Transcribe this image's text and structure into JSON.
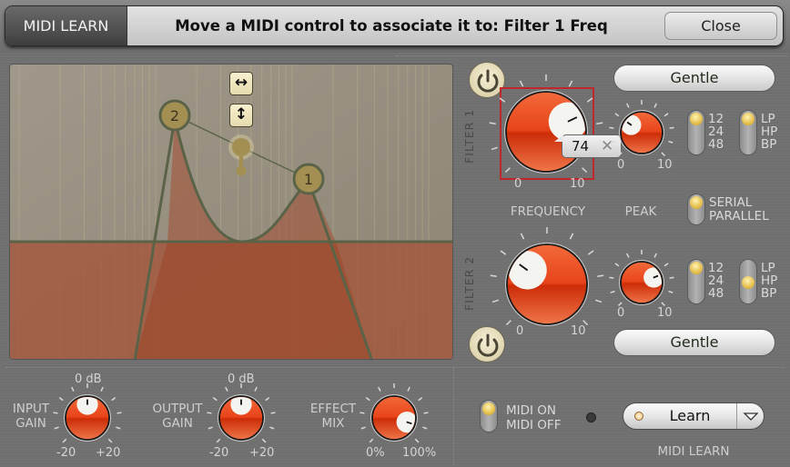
{
  "midi_banner": {
    "tag": "MIDI LEARN",
    "message": "Move a MIDI control to associate it to: Filter 1 Freq",
    "close_label": "Close"
  },
  "graph": {
    "node_labels": [
      "2",
      "1"
    ],
    "icons": [
      "horizontal-move-icon",
      "vertical-move-icon"
    ],
    "colors": {
      "background": "#928b7d",
      "fill": "#a4553a",
      "curve": "#5a6347",
      "node": "#a38f52"
    }
  },
  "filter1": {
    "label": "FILTER 1",
    "mode_button": "Gentle",
    "frequency": {
      "value_fraction": 0.74,
      "min_label": "0",
      "max_label": "10",
      "midi_value": "74"
    },
    "peak": {
      "value_fraction": 0.3,
      "min_label": "0",
      "max_label": "10"
    },
    "slope": {
      "options": [
        "12",
        "24",
        "48"
      ],
      "selected": "12"
    },
    "type": {
      "options": [
        "LP",
        "HP",
        "BP"
      ],
      "selected": "LP"
    },
    "learn_highlight_color": "#c0272d"
  },
  "filter2": {
    "label": "FILTER 2",
    "mode_button": "Gentle",
    "frequency": {
      "value_fraction": 0.3,
      "min_label": "0",
      "max_label": "10"
    },
    "peak": {
      "value_fraction": 0.75,
      "min_label": "0",
      "max_label": "10"
    },
    "slope": {
      "options": [
        "12",
        "24",
        "48"
      ],
      "selected": "12"
    },
    "type": {
      "options": [
        "LP",
        "HP",
        "BP"
      ],
      "selected": "HP"
    }
  },
  "labels": {
    "frequency": "FREQUENCY",
    "peak": "PEAK",
    "routing": {
      "options": [
        "SERIAL",
        "PARALLEL"
      ],
      "selected": "SERIAL"
    }
  },
  "bottom": {
    "input_gain": {
      "label_line1": "INPUT",
      "label_line2": "GAIN",
      "center_label": "0 dB",
      "min_label": "-20",
      "max_label": "+20",
      "value_fraction": 0.5
    },
    "output_gain": {
      "label_line1": "OUTPUT",
      "label_line2": "GAIN",
      "center_label": "0 dB",
      "min_label": "-20",
      "max_label": "+20",
      "value_fraction": 0.5
    },
    "effect_mix": {
      "label_line1": "EFFECT",
      "label_line2": "MIX",
      "min_label": "0%",
      "max_label": "100%",
      "value_fraction": 0.9
    },
    "midi_switch": {
      "options": [
        "MIDI ON",
        "MIDI OFF"
      ],
      "selected": "MIDI ON"
    },
    "learn_button": "Learn",
    "midi_learn_label": "MIDI LEARN"
  },
  "colors": {
    "knob_red": "#e8401a",
    "led_yellow": "#e6bc3e",
    "panel_gray": "#707070"
  }
}
